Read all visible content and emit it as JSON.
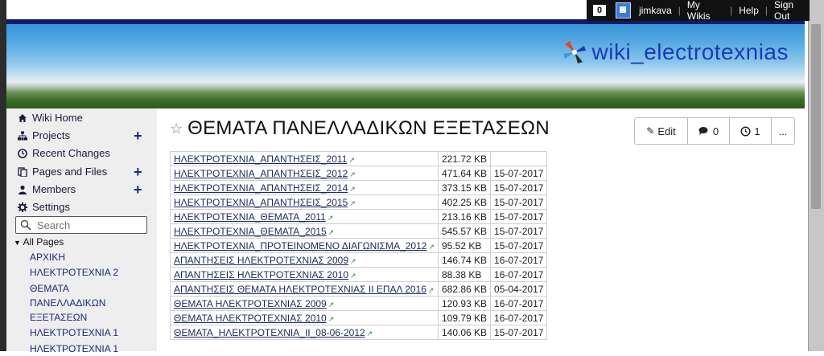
{
  "brand": {
    "title": "wiki_electrotexnias"
  },
  "userbar": {
    "count": "0",
    "username": "jimkava",
    "links": [
      "My Wikis",
      "Help",
      "Sign Out"
    ]
  },
  "sidebar": {
    "nav": [
      {
        "label": "Wiki Home",
        "icon": "home-icon",
        "plus": false
      },
      {
        "label": "Projects",
        "icon": "sitemap-icon",
        "plus": true
      },
      {
        "label": "Recent Changes",
        "icon": "clock-icon",
        "plus": false
      },
      {
        "label": "Pages and Files",
        "icon": "files-icon",
        "plus": true
      },
      {
        "label": "Members",
        "icon": "user-icon",
        "plus": true
      },
      {
        "label": "Settings",
        "icon": "gear-icon",
        "plus": false
      }
    ],
    "search_placeholder": "Search",
    "all_pages_label": "All Pages",
    "pages": [
      "ΑΡΧΙΚΗ",
      "ΗΛΕΚΤΡΟΤΕΧΝΙΑ 2",
      "ΘΕΜΑΤΑ",
      "ΠΑΝΕΛΛΑΔΙΚΩΝ",
      "ΕΞΕΤΑΣΕΩΝ",
      "ΗΛΕΚΤΡΟΤΕΧΝΙΑ 1",
      "ΗΛΕΚΤΡΟΤΕΧΝΙΑ 1"
    ]
  },
  "main": {
    "title": "ΘΕΜΑΤΑ ΠΑΝΕΛΛΑΔΙΚΩΝ ΕΞΕΤΑΣΕΩΝ",
    "actions": {
      "edit": "Edit",
      "comments": "0",
      "history": "1",
      "more": "..."
    },
    "files": [
      {
        "name": "ΗΛΕΚΤΡΟΤΕΧΝΙΑ_ΑΠΑΝΤΗΣΕΙΣ_2011",
        "size": "221.72 KB",
        "date": ""
      },
      {
        "name": "ΗΛΕΚΤΡΟΤΕΧΝΙΑ_ΑΠΑΝΤΗΣΕΙΣ_2012",
        "size": "471.64 KB",
        "date": "15-07-2017"
      },
      {
        "name": "ΗΛΕΚΤΡΟΤΕΧΝΙΑ_ΑΠΑΝΤΗΣΕΙΣ_2014",
        "size": "373.15 KB",
        "date": "15-07-2017"
      },
      {
        "name": "ΗΛΕΚΤΡΟΤΕΧΝΙΑ_ΑΠΑΝΤΗΣΕΙΣ_2015",
        "size": "402.25 KB",
        "date": "15-07-2017"
      },
      {
        "name": "ΗΛΕΚΤΡΟΤΕΧΝΙΑ_ΘΕΜΑΤΑ_2011",
        "size": "213.16 KB",
        "date": "15-07-2017"
      },
      {
        "name": "ΗΛΕΚΤΡΟΤΕΧΝΙΑ_ΘΕΜΑΤΑ_2015",
        "size": "545.57 KB",
        "date": "15-07-2017"
      },
      {
        "name": "ΗΛΕΚΤΡΟΤΕΧΝΙΑ_ΠΡΟΤΕΙΝΟΜΕΝΟ ΔΙΑΓΩΝΙΣΜΑ_2012",
        "size": "95.52 KB",
        "date": "15-07-2017"
      },
      {
        "name": "ΑΠΑΝΤΗΣΕΙΣ ΗΛΕΚΤΡΟΤΕΧΝΙΑΣ 2009",
        "size": "146.74 KB",
        "date": "16-07-2017"
      },
      {
        "name": "ΑΠΑΝΤΗΣΕΙΣ ΗΛΕΚΤΡΟΤΕΧΝΙΑΣ 2010",
        "size": "88.38 KB",
        "date": "16-07-2017"
      },
      {
        "name": "ΑΠΑΝΤΗΣΕΙΣ ΘΕΜΑΤΑ ΗΛΕΚΤΡΟΤΕΧΝΙΑΣ ΙΙ ΕΠΑΛ 2016",
        "size": "682.86 KB",
        "date": "05-04-2017"
      },
      {
        "name": "ΘΕΜΑΤΑ ΗΛΕΚΤΡΟΤΕΧΝΙΑΣ 2009",
        "size": "120.93 KB",
        "date": "16-07-2017"
      },
      {
        "name": "ΘΕΜΑΤΑ ΗΛΕΚΤΡΟΤΕΧΝΙΑΣ 2010",
        "size": "109.79 KB",
        "date": "16-07-2017"
      },
      {
        "name": "ΘΕΜΑΤΑ_ΗΛΕΚΤΡΟΤΕΧΝΙΑ_ΙΙ_08-06-2012",
        "size": "140.06 KB",
        "date": "15-07-2017"
      }
    ]
  },
  "colors": {
    "brand_text": "#1b3bb0",
    "sidebar_bg": "#eeeeee",
    "link": "#1a2a5a"
  }
}
